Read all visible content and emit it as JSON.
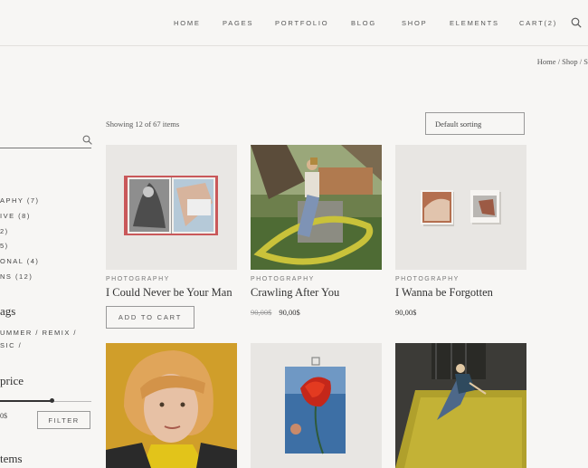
{
  "nav": {
    "items": [
      {
        "label": "HOME"
      },
      {
        "label": "PAGES"
      },
      {
        "label": "PORTFOLIO"
      },
      {
        "label": "BLOG"
      },
      {
        "label": "SHOP"
      },
      {
        "label": "ELEMENTS"
      },
      {
        "label": "CART(2)"
      }
    ],
    "search_icon": "search-icon"
  },
  "breadcrumb": {
    "text": "Home / Shop / S"
  },
  "sidebar": {
    "search_icon": "search-icon",
    "categories": [
      {
        "label": "APHY (7)"
      },
      {
        "label": "IVE (8)"
      },
      {
        "label": "2)"
      },
      {
        "label": "5)"
      },
      {
        "label": "ONAL (4)"
      },
      {
        "label": "NS (12)"
      }
    ],
    "tags_heading": "ags",
    "tags": [
      {
        "label": "UMMER / REMIX /"
      },
      {
        "label": "SIC /"
      }
    ],
    "price_heading": "price",
    "price_range": "0$",
    "price_slider_fraction": 0.56,
    "filter_label": "FILTER",
    "items_heading": "tems"
  },
  "shop": {
    "showing": "Showing 12 of 67 items",
    "sorting": "Default sorting"
  },
  "products": [
    {
      "category": "PHOTOGRAPHY",
      "title": "I Could Never be Your Man",
      "button": "ADD TO CART"
    },
    {
      "category": "PHOTOGRAPHY",
      "title": "Crawling After You",
      "old_price": "90,00$",
      "price": "90,00$"
    },
    {
      "category": "PHOTOGRAPHY",
      "title": "I Wanna be Forgotten",
      "price": "90,00$"
    },
    {},
    {},
    {}
  ],
  "colors": {
    "background": "#f7f6f4",
    "text": "#333333",
    "border": "#999999"
  }
}
